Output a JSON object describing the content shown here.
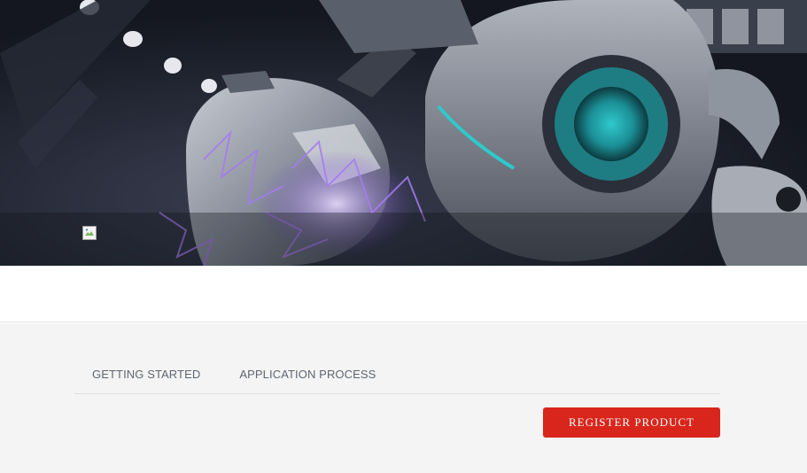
{
  "hero": {
    "image_icon": "broken-image-icon"
  },
  "tabs": [
    {
      "label": "GETTING STARTED"
    },
    {
      "label": "APPLICATION PROCESS"
    }
  ],
  "register": {
    "label": "REGISTER PRODUCT"
  },
  "colors": {
    "accent": "#d9261c",
    "content_bg": "#f4f4f4",
    "tab_text": "#5f6670"
  }
}
